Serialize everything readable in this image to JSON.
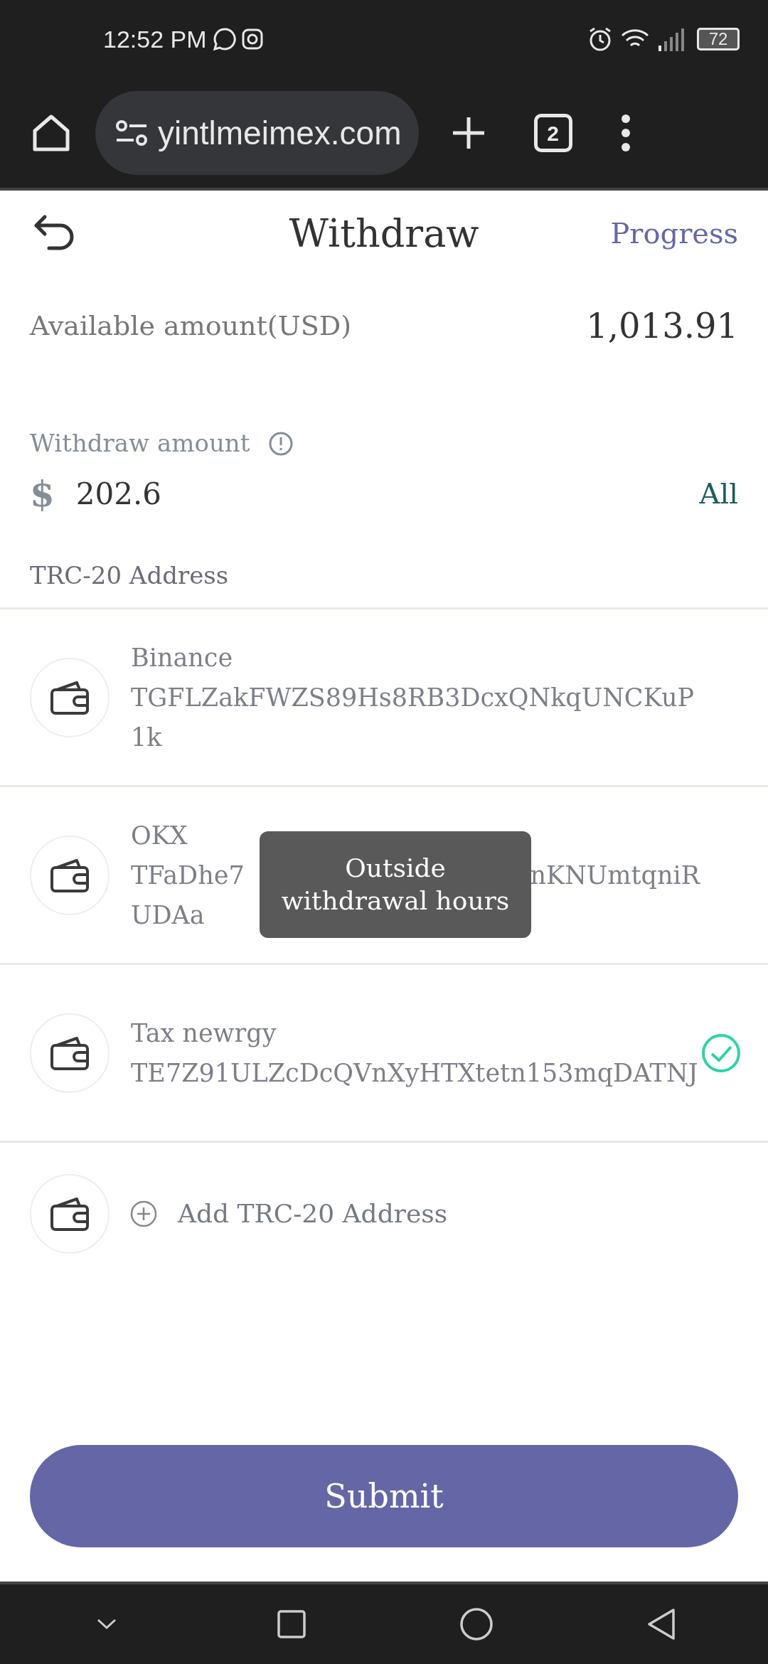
{
  "status_bar": {
    "time": "12:52 PM",
    "battery": "72"
  },
  "browser": {
    "url": "yintlmeimex.com",
    "tab_count": "2"
  },
  "header": {
    "title": "Withdraw",
    "progress": "Progress"
  },
  "available": {
    "label": "Available amount(USD)",
    "value": "1,013.91"
  },
  "withdraw_amount": {
    "label": "Withdraw amount",
    "currency": "$",
    "value": "202.6",
    "all": "All"
  },
  "address_section": {
    "label": "TRC-20 Address"
  },
  "addresses": [
    {
      "name": "Binance",
      "address": "TGFLZakFWZS89Hs8RB3DcxQNkqUNCKuP1k",
      "selected": false
    },
    {
      "name": "OKX",
      "address_fragments": [
        "TFaDhe7",
        "nKNUmtqniR",
        "UDAa"
      ],
      "selected": false
    },
    {
      "name": "Tax newrgy",
      "address": "TE7Z91ULZcDcQVnXyHTXtetn153mqDATNJ",
      "selected": true
    }
  ],
  "add_address": "Add TRC-20 Address",
  "submit": "Submit",
  "toast": "Outside withdrawal hours"
}
